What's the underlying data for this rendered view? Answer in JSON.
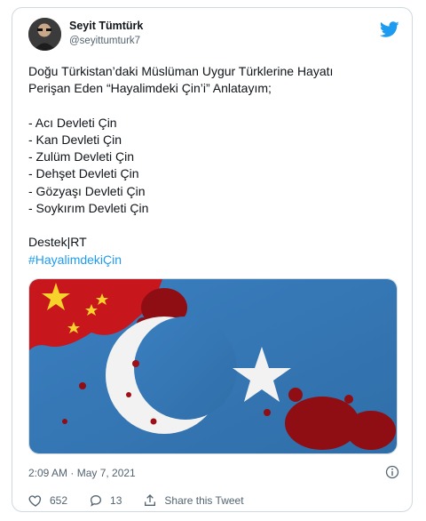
{
  "tweet": {
    "author_name": "Seyit Tümtürk",
    "author_handle": "@seyittumturk7",
    "text_lines": [
      "Doğu Türkistan’daki Müslüman Uygur Türklerine Hayatı",
      "Perişan Eden “Hayalimdeki Çin’i” Anlatayım;",
      "",
      "- Acı Devleti Çin",
      "- Kan Devleti Çin",
      "- Zulüm Devleti Çin",
      "- Dehşet Devleti Çin",
      "- Gözyaşı Devleti Çin",
      "- Soykırım Devleti Çin",
      "",
      "Destek|RT"
    ],
    "hashtag": "#HayalimdekiÇin",
    "timestamp": "2:09 AM · May 7, 2021",
    "likes": "652",
    "replies": "13",
    "share_label": "Share this Tweet"
  },
  "icons": {
    "brand": "twitter-bird-icon",
    "info": "info-icon",
    "like": "heart-icon",
    "reply": "reply-icon",
    "share": "share-icon"
  },
  "colors": {
    "brand": "#1d9bf0",
    "text": "#0f1419",
    "muted": "#536471",
    "border": "#cfd9de"
  }
}
